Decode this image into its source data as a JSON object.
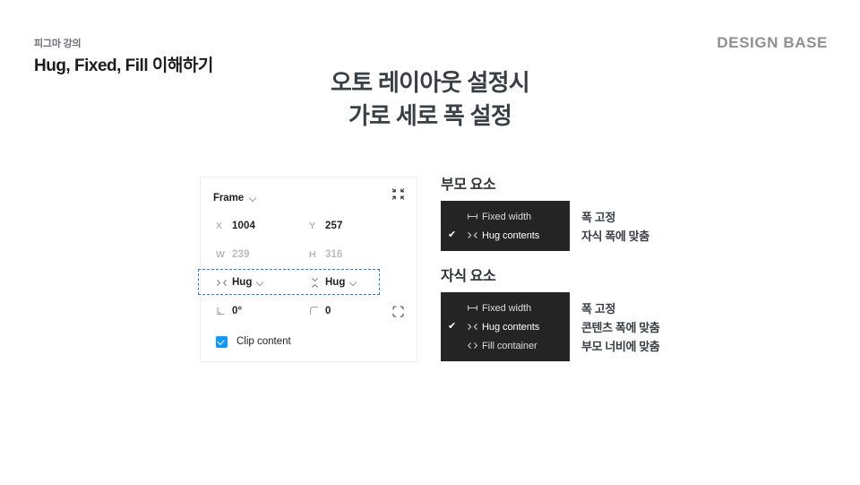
{
  "header": {
    "eyebrow": "피그마 강의",
    "deck_title": "Hug, Fixed, Fill 이해하기",
    "brand": "DESIGN BASE"
  },
  "title": {
    "line1": "오토 레이아웃 설정시",
    "line2": "가로 세로 폭 설정"
  },
  "figma_panel": {
    "frame_label": "Frame",
    "collapse_icon": "collapse-icon",
    "x_label": "X",
    "x_value": "1004",
    "y_label": "Y",
    "y_value": "257",
    "w_label": "W",
    "w_value": "239",
    "h_label": "H",
    "h_value": "316",
    "horizontal_resizing": "Hug",
    "vertical_resizing": "Hug",
    "rotation_value": "0°",
    "corner_radius_value": "0",
    "clip_content_label": "Clip content",
    "clip_content_checked": true,
    "selection_color": "#1e7bf0",
    "accent_color": "#0d99ff"
  },
  "parent_section": {
    "title": "부모 요소",
    "menu_bg": "#242424",
    "options": [
      {
        "icon": "fixed-width-icon",
        "label": "Fixed width",
        "checked": false,
        "note": "폭 고정"
      },
      {
        "icon": "hug-contents-icon",
        "label": "Hug contents",
        "checked": true,
        "note": "자식 폭에 맞춤"
      }
    ]
  },
  "child_section": {
    "title": "자식 요소",
    "menu_bg": "#242424",
    "options": [
      {
        "icon": "fixed-width-icon",
        "label": "Fixed width",
        "checked": false,
        "note": "폭 고정"
      },
      {
        "icon": "hug-contents-icon",
        "label": "Hug contents",
        "checked": true,
        "note": "콘텐츠 폭에 맞춤"
      },
      {
        "icon": "fill-container-icon",
        "label": "Fill container",
        "checked": false,
        "note": "부모 너비에 맞춤"
      }
    ]
  },
  "check_glyph": "✔"
}
